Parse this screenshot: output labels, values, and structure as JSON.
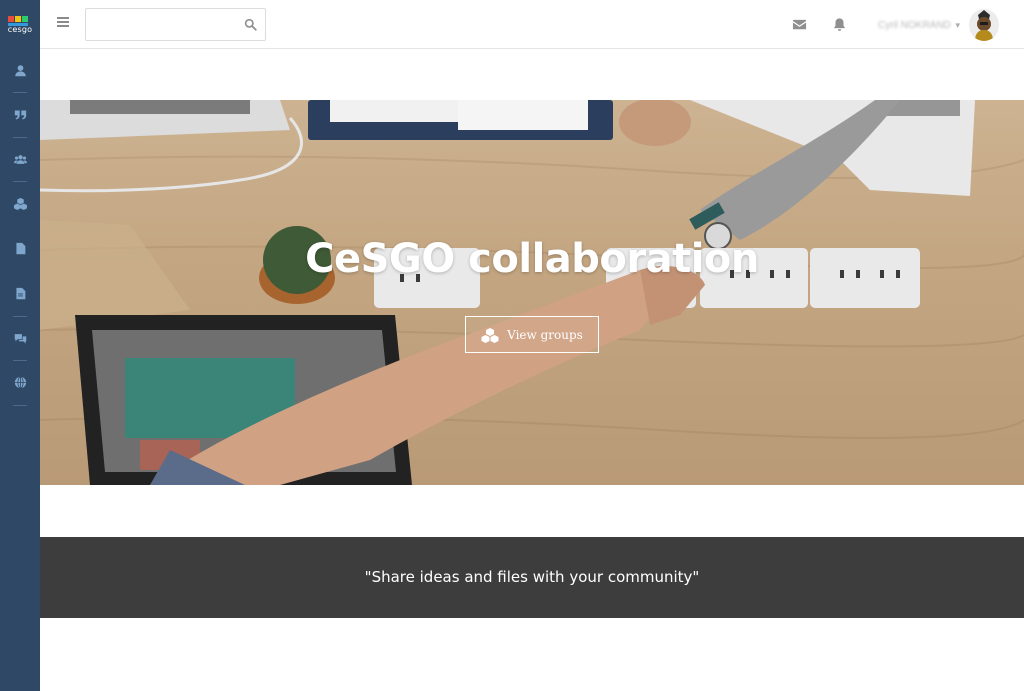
{
  "sidebar": {
    "logo_text": "cesgo",
    "items": [
      {
        "icon": "user-icon"
      },
      {
        "icon": "quote-icon"
      },
      {
        "icon": "users-icon"
      },
      {
        "icon": "cubes-icon"
      },
      {
        "icon": "file-icon"
      },
      {
        "icon": "file-text-icon"
      },
      {
        "icon": "comments-icon"
      },
      {
        "icon": "globe-icon"
      }
    ],
    "colors": {
      "background": "#2e4865",
      "icon": "#7fa6cc"
    }
  },
  "topbar": {
    "search": {
      "value": "",
      "placeholder": ""
    },
    "icons": [
      "menu-icon",
      "search-icon",
      "envelope-icon",
      "bell-icon",
      "caret-down-icon"
    ],
    "user_name": "Cyril NOKRAND"
  },
  "hero": {
    "title": "CeSGO collaboration",
    "button_label": "View groups",
    "button_icon": "cubes-icon"
  },
  "quote": {
    "text": "\"Share ideas and files with your community\"",
    "background": "#3d3d3d"
  }
}
